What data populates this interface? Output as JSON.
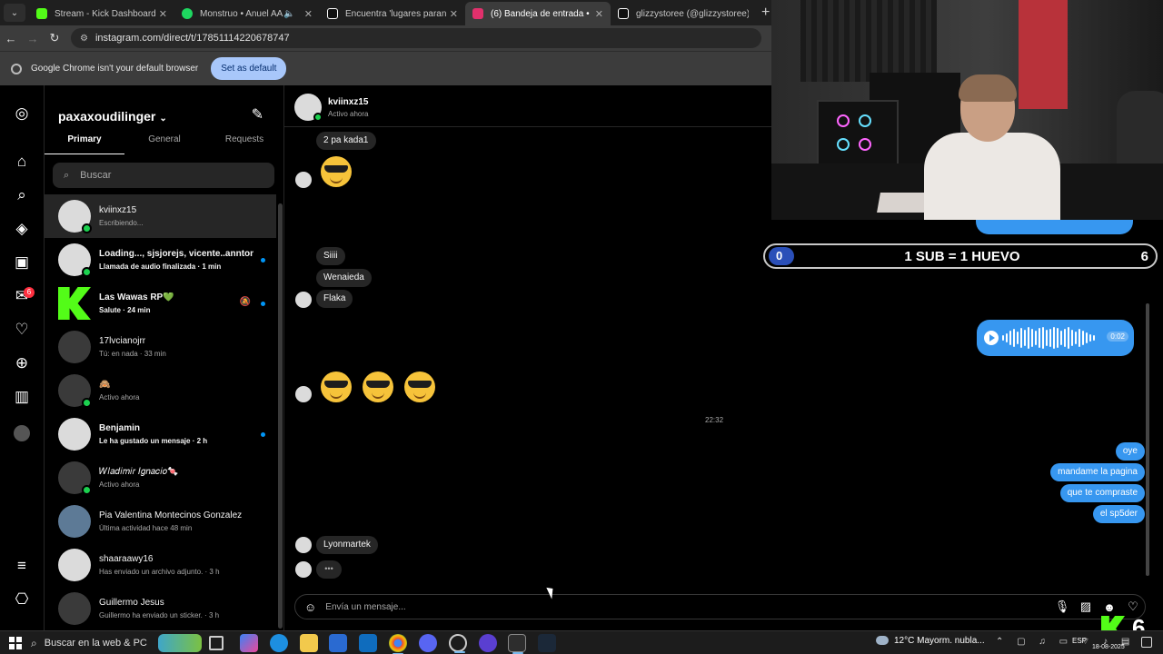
{
  "browser": {
    "tabs": [
      {
        "title": "Stream - Kick Dashboard",
        "favicon_color": "#53fc18",
        "active": false
      },
      {
        "title": "Monstruo • Anuel AA",
        "favicon_color": "#1ed760",
        "active": false,
        "muted": true
      },
      {
        "title": "Encuentra 'lugares paranormal",
        "favicon_color": "#ffffff",
        "active": false
      },
      {
        "title": "(6) Bandeja de entrada • Chats",
        "favicon_color": "#e1306c",
        "active": true
      },
      {
        "title": "glizzystoree (@glizzystoree) | Ti",
        "favicon_color": "#ffffff",
        "active": false
      }
    ],
    "url": "instagram.com/direct/t/17851114220678747",
    "infobar_text": "Google Chrome isn't your default browser",
    "infobar_button": "Set as default"
  },
  "rail": {
    "notification_count": "6"
  },
  "inbox": {
    "username": "paxaxoudilinger",
    "tabs": [
      "Primary",
      "General",
      "Requests"
    ],
    "search_placeholder": "Buscar",
    "conversations": [
      {
        "name": "kviinxz15",
        "sub": "Escribiendo...",
        "online": true,
        "selected": true,
        "bold": false,
        "unread": false
      },
      {
        "name": "Loading..., sjsjorejs, vicente..anntoni...",
        "sub": "Llamada de audio finalizada · 1 min",
        "online": true,
        "selected": false,
        "bold": true,
        "unread": true
      },
      {
        "name": "Las Wawas RP💚",
        "sub": "Salute · 24 min",
        "online": true,
        "selected": false,
        "bold": true,
        "unread": true,
        "muted": true
      },
      {
        "name": "17lvcianojrr",
        "sub": "Tú: en nada · 33 min",
        "online": false,
        "selected": false,
        "bold": false,
        "unread": false
      },
      {
        "name": "🙈",
        "sub": "Activo ahora",
        "online": true,
        "selected": false,
        "bold": false,
        "unread": false
      },
      {
        "name": "Benjamin",
        "sub": "Le ha gustado un mensaje · 2 h",
        "online": false,
        "selected": false,
        "bold": true,
        "unread": true
      },
      {
        "name": "𝑊𝑙𝑎𝑑𝑖𝑚𝑖𝑟 𝐼𝑔𝑛𝑎𝑐𝑖𝑜🍬",
        "sub": "Activo ahora",
        "online": true,
        "selected": false,
        "bold": false,
        "unread": false
      },
      {
        "name": "Pia Valentina Montecinos Gonzalez",
        "sub": "Última actividad hace 48 min",
        "online": false,
        "selected": false,
        "bold": false,
        "unread": false
      },
      {
        "name": "shaaraawy16",
        "sub": "Has enviado un archivo adjunto. · 3 h",
        "online": false,
        "selected": false,
        "bold": false,
        "unread": false
      },
      {
        "name": "Guillermo Jesus",
        "sub": "Guillermo ha enviado un sticker. · 3 h",
        "online": false,
        "selected": false,
        "bold": false,
        "unread": false
      }
    ]
  },
  "chat": {
    "contact_name": "kviinxz15",
    "contact_status": "Activo ahora",
    "messages_in": [
      "2 pa kada1",
      "Siiii",
      "Wenaieda",
      "Flaka",
      "Lyonmartek"
    ],
    "messages_out": [
      "oye",
      "mandame la pagina",
      "que te compraste",
      "el sp5der"
    ],
    "timestamp": "22:32",
    "audio_duration": "0:02",
    "composer_placeholder": "Envía un mensaje...",
    "typing_indicator": "•••"
  },
  "stream_overlay": {
    "goal_start": "0",
    "goal_label": "1 SUB = 1 HUEVO",
    "goal_end": "6",
    "viewer_count": "6"
  },
  "taskbar": {
    "search_placeholder": "Buscar en la web & PC",
    "weather": "12°C  Mayorm. nubla...",
    "language": "ESP",
    "date": "18-08-2025"
  }
}
